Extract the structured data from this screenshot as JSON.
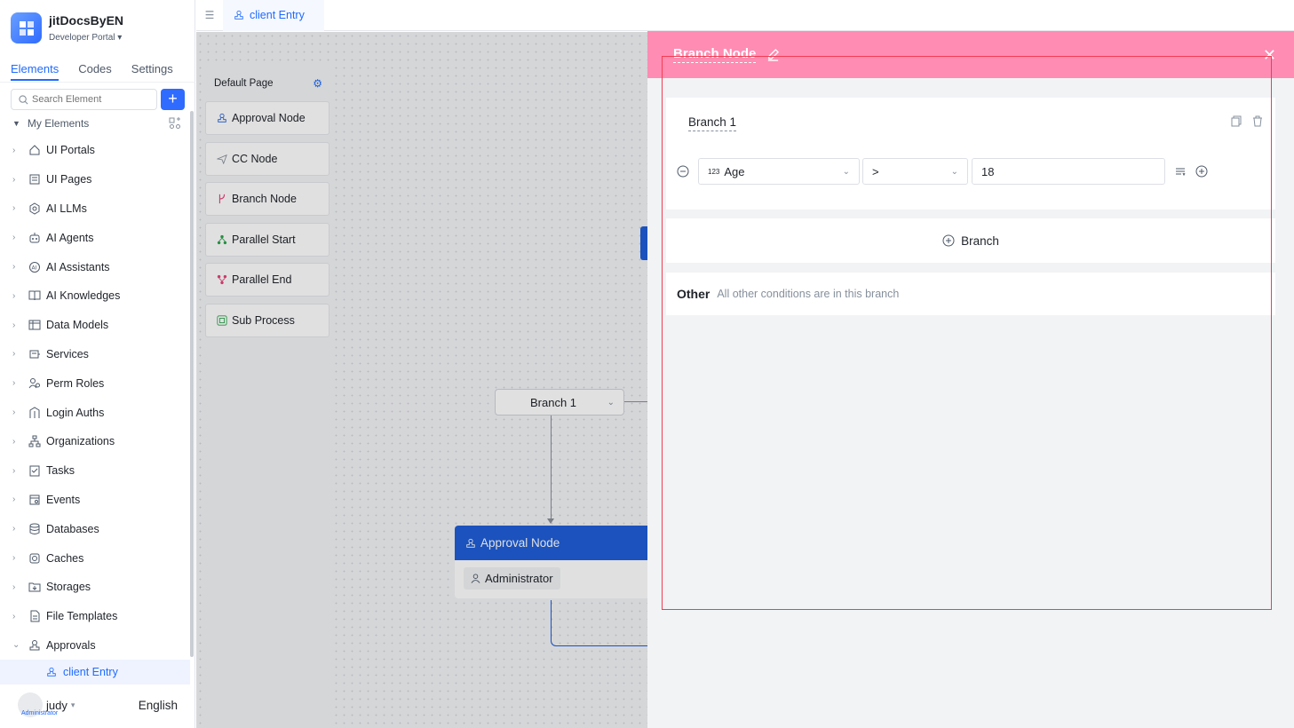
{
  "app": {
    "name": "jitDocsByEN",
    "subtitle": "Developer Portal"
  },
  "sidebar": {
    "tabs": [
      "Elements",
      "Codes",
      "Settings"
    ],
    "search_placeholder": "Search Element",
    "add_label": "+",
    "section_label": "My Elements",
    "items": [
      {
        "label": "UI Portals",
        "icon": "home-icon"
      },
      {
        "label": "UI Pages",
        "icon": "page-icon"
      },
      {
        "label": "AI LLMs",
        "icon": "llm-icon"
      },
      {
        "label": "AI Agents",
        "icon": "robot-icon"
      },
      {
        "label": "AI Assistants",
        "icon": "assistant-icon"
      },
      {
        "label": "AI Knowledges",
        "icon": "book-icon"
      },
      {
        "label": "Data Models",
        "icon": "table-icon"
      },
      {
        "label": "Services",
        "icon": "services-icon"
      },
      {
        "label": "Perm Roles",
        "icon": "roles-icon"
      },
      {
        "label": "Login Auths",
        "icon": "login-icon"
      },
      {
        "label": "Organizations",
        "icon": "org-icon"
      },
      {
        "label": "Tasks",
        "icon": "tasks-icon"
      },
      {
        "label": "Events",
        "icon": "events-icon"
      },
      {
        "label": "Databases",
        "icon": "database-icon"
      },
      {
        "label": "Caches",
        "icon": "cache-icon"
      },
      {
        "label": "Storages",
        "icon": "storage-icon"
      },
      {
        "label": "File Templates",
        "icon": "file-icon"
      },
      {
        "label": "Approvals",
        "icon": "approval-icon"
      }
    ],
    "active_child": "client Entry",
    "user": {
      "name": "judy",
      "role": "Administrator",
      "language": "English"
    }
  },
  "topbar": {
    "tab_label": "client Entry"
  },
  "canvas": {
    "panel_title": "Default Page",
    "nodes": [
      "Approval Node",
      "CC Node",
      "Branch Node",
      "Parallel Start",
      "Parallel End",
      "Sub Process"
    ],
    "branch_pill": "Branch 1",
    "approval_title": "Approval Node",
    "approver": "Administrator"
  },
  "drawer": {
    "title": "Branch Node",
    "branch_name": "Branch 1",
    "condition": {
      "field": "Age",
      "field_type": "123",
      "operator": ">",
      "value": "18"
    },
    "add_branch_label": "Branch",
    "other_title": "Other",
    "other_desc": "All other conditions are in this branch",
    "header_color": "#ff8cb3",
    "highlight_color": "#f23c52"
  },
  "colors": {
    "accent": "#1f6bff",
    "approval_blue": "#1f5ed8"
  }
}
